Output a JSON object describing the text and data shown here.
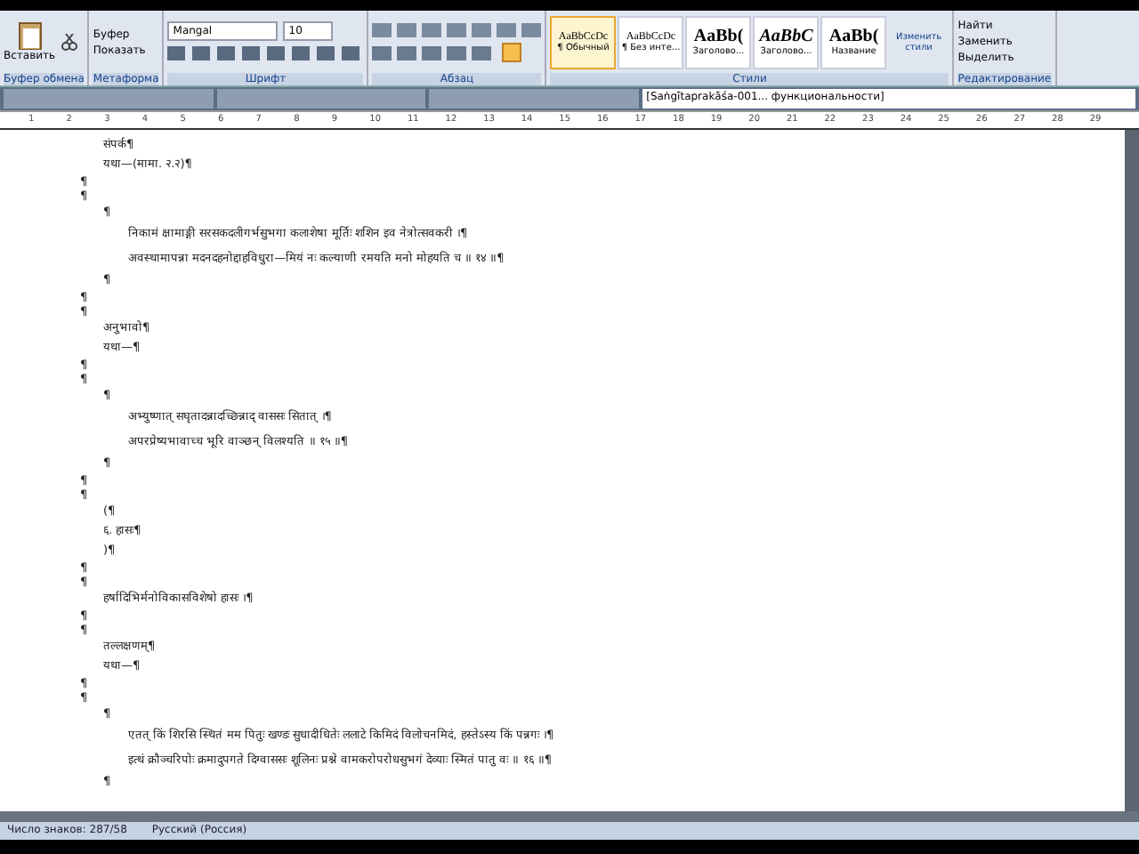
{
  "ribbon": {
    "clipboard": {
      "paste": "Вставить",
      "label": "Буфер обмена"
    },
    "group_2": {
      "items": [
        "Буфер",
        "Показать"
      ],
      "label": "Метаформа"
    },
    "font": {
      "family": "Mangal",
      "size": "10",
      "label": "Шрифт"
    },
    "paragraph": {
      "label": "Абзац",
      "show_marks": true
    },
    "styles": {
      "label": "Стили",
      "items": [
        {
          "preview": "AaBbCcDc",
          "name": "¶ Обычный",
          "selected": true,
          "kind": "small"
        },
        {
          "preview": "AaBbCcDc",
          "name": "¶ Без инте...",
          "selected": false,
          "kind": "small"
        },
        {
          "preview": "AaBb(",
          "name": "Заголово...",
          "selected": false,
          "kind": "bold"
        },
        {
          "preview": "AaBbC",
          "name": "Заголово...",
          "selected": false,
          "kind": "italic"
        },
        {
          "preview": "AaBb(",
          "name": "Название",
          "selected": false,
          "kind": "bold"
        }
      ],
      "change": "Изменить стили"
    },
    "editing": {
      "label": "Редактирование",
      "items": [
        "Найти",
        "Заменить",
        "Выделить"
      ]
    }
  },
  "document_tabs": [
    {
      "selected": false
    },
    {
      "selected": false
    },
    {
      "selected": false
    },
    {
      "title": "[Saṅgītaprakāśa-001... функциональности]",
      "selected": true
    }
  ],
  "ruler": [
    "1",
    "2",
    "3",
    "4",
    "5",
    "6",
    "7",
    "8",
    "9",
    "10",
    "11",
    "12",
    "13",
    "14",
    "15",
    "16",
    "17",
    "18",
    "19",
    "20",
    "21",
    "22",
    "23",
    "24",
    "25",
    "26",
    "27",
    "28",
    "29"
  ],
  "paragraphs": [
    {
      "kind": "normal",
      "text": "संपर्क¶"
    },
    {
      "kind": "normal",
      "text": "यथा—(मामा. २.२)¶"
    },
    {
      "kind": "margin",
      "text": "¶"
    },
    {
      "kind": "margin",
      "text": "¶"
    },
    {
      "kind": "normal",
      "text": "¶"
    },
    {
      "kind": "verse",
      "text": "निकामं क्षामाङ्गी सरसकदलीगर्भसुभगा कलाशेषा मूर्तिः शशिन इव नेत्रोत्सवकरी ।¶"
    },
    {
      "kind": "verse",
      "text": "अवस्थामापन्ना मदनदहनोद्दाहविधुरा—मियं नः कल्याणी रमयति मनो मोहयति च ॥ १४ ॥¶"
    },
    {
      "kind": "normal",
      "text": "¶"
    },
    {
      "kind": "margin",
      "text": "¶"
    },
    {
      "kind": "margin",
      "text": "¶"
    },
    {
      "kind": "normal",
      "text": "अनुभावो¶"
    },
    {
      "kind": "normal",
      "text": "यथा—¶"
    },
    {
      "kind": "margin",
      "text": "¶"
    },
    {
      "kind": "margin",
      "text": "¶"
    },
    {
      "kind": "normal",
      "text": "¶"
    },
    {
      "kind": "verse",
      "text": "अभ्युष्णात् सघृतादन्नादच्छिन्नाद् वाससः सितात् ।¶"
    },
    {
      "kind": "verse",
      "text": "अपरप्रेष्यभावाच्च भूरि वाञ्छन् विलश्यति ॥ १५ ॥¶"
    },
    {
      "kind": "normal",
      "text": "¶"
    },
    {
      "kind": "margin",
      "text": "¶"
    },
    {
      "kind": "margin",
      "text": "¶"
    },
    {
      "kind": "normal",
      "text": "(¶"
    },
    {
      "kind": "normal",
      "text": "६. हासः¶"
    },
    {
      "kind": "normal",
      "text": ")¶"
    },
    {
      "kind": "margin",
      "text": "¶"
    },
    {
      "kind": "margin",
      "text": "¶"
    },
    {
      "kind": "normal",
      "text": "हर्षादिभिर्मनोविकासविशेषो हासः ।¶"
    },
    {
      "kind": "margin",
      "text": "¶"
    },
    {
      "kind": "margin",
      "text": "¶"
    },
    {
      "kind": "normal",
      "text": "तल्लक्षणम्¶"
    },
    {
      "kind": "normal",
      "text": "यथा—¶"
    },
    {
      "kind": "margin",
      "text": "¶"
    },
    {
      "kind": "margin",
      "text": "¶"
    },
    {
      "kind": "normal",
      "text": "¶"
    },
    {
      "kind": "verse",
      "text": "एतत् किं शिरसि स्थितं मम पितुः खण्डः सुधादीधितेः ललाटे किमिदं विलोचनमिदं, हस्तेऽस्य किं पन्नगः ।¶"
    },
    {
      "kind": "verse",
      "text": "इत्थं क्रौञ्चरिपोः क्रमादुपगते दिग्वाससः शूलिनः प्रश्ने वामकरोपरोधसुभगं देव्याः स्मितं पातु वः ॥ १६ ॥¶"
    },
    {
      "kind": "normal",
      "text": "¶"
    }
  ],
  "status_bar": {
    "word_count": "Число знаков: 287/58",
    "language": "Русский (Россия)"
  }
}
